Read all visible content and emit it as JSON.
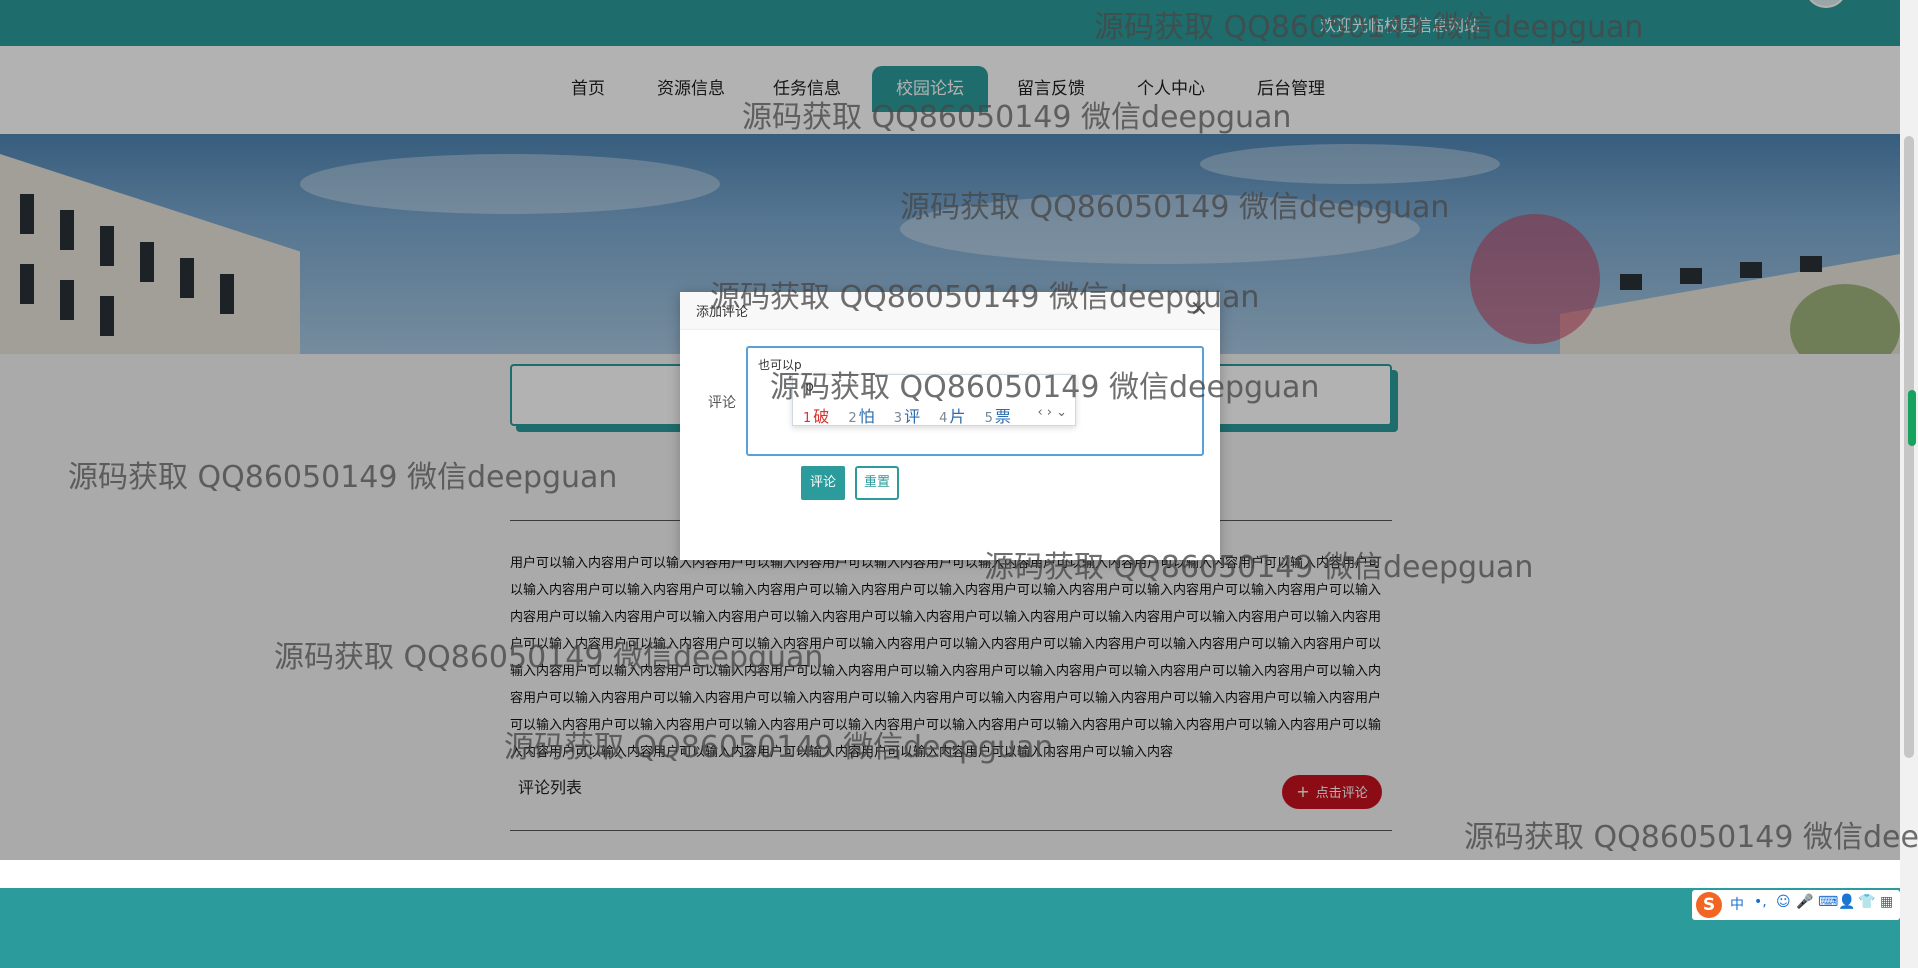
{
  "header": {
    "welcome": "欢迎光临校园信息网站"
  },
  "nav": {
    "items": [
      {
        "label": "首页"
      },
      {
        "label": "资源信息"
      },
      {
        "label": "任务信息"
      },
      {
        "label": "校园论坛",
        "active": true
      },
      {
        "label": "留言反馈"
      },
      {
        "label": "个人中心"
      },
      {
        "label": "后台管理"
      }
    ]
  },
  "article": {
    "text": "用户可以输入内容用户可以输入内容用户可以输入内容用户可以输入内容用户可以输入内容用户可以输入内容用户可以输入内容用户可以输入内容用户可以输入内容用户可以输入内容用户可以输入内容用户可以输入内容用户可以输入内容用户可以输入内容用户可以输入内容用户可以输入内容用户可以输入内容用户可以输入内容用户可以输入内容用户可以输入内容用户可以输入内容用户可以输入内容用户可以输入内容用户可以输入内容用户可以输入内容用户可以输入内容用户可以输入内容用户可以输入内容用户可以输入内容用户可以输入内容用户可以输入内容用户可以输入内容用户可以输入内容用户可以输入内容用户可以输入内容用户可以输入内容用户可以输入内容用户可以输入内容用户可以输入内容用户可以输入内容用户可以输入内容用户可以输入内容用户可以输入内容用户可以输入内容用户可以输入内容用户可以输入内容用户可以输入内容用户可以输入内容用户可以输入内容用户可以输入内容用户可以输入内容用户可以输入内容用户可以输入内容用户可以输入内容用户可以输入内容用户可以输入内容用户可以输入内容用户可以输入内容用户可以输入内容用户可以输入内容用户可以输入内容用户可以输入内容用户可以输入内容用户可以输入内容用户可以输入内容"
  },
  "comments": {
    "title": "评论列表",
    "add_button": "点击评论"
  },
  "dialog": {
    "title": "添加评论",
    "close": "×",
    "label": "评论",
    "textarea_value": "也可以p",
    "submit": "评论",
    "reset": "重置"
  },
  "ime": {
    "input": "p",
    "candidates": [
      {
        "num": "1",
        "text": "破"
      },
      {
        "num": "2",
        "text": "怕"
      },
      {
        "num": "3",
        "text": "评"
      },
      {
        "num": "4",
        "text": "片"
      },
      {
        "num": "5",
        "text": "票"
      }
    ],
    "arrows": "‹ › ⌄"
  },
  "tray": {
    "logo": "S",
    "items": [
      "中",
      "•,",
      "☺",
      "🎤",
      "⌨",
      "👤",
      "👕",
      "▦"
    ]
  },
  "watermark": {
    "text": "源码获取 QQ86050149 微信deepguan",
    "text_cut": "源码获取 QQ86050149 微信deep"
  },
  "colors": {
    "primary": "#2b9b9b",
    "danger": "#c8121e",
    "ime_highlight": "#d9342b"
  }
}
